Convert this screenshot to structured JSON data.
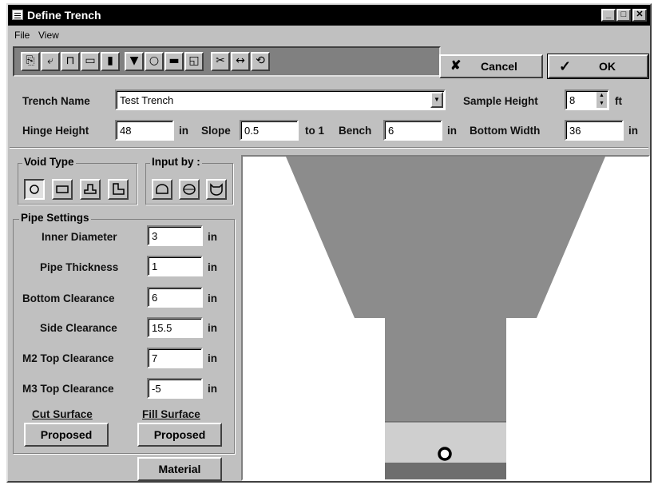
{
  "window": {
    "title": "Define Trench",
    "min_label": "_",
    "max_label": "□",
    "close_label": "✕"
  },
  "menu": {
    "file": "File",
    "view": "View"
  },
  "toolbar": {
    "tools": [
      {
        "icon": "copy-icon",
        "glyph": "⎘"
      },
      {
        "icon": "paste-icon",
        "glyph": "⤶"
      },
      {
        "icon": "trench-shape-icon",
        "glyph": "⊓"
      },
      {
        "icon": "window-icon",
        "glyph": "▭"
      },
      {
        "icon": "chart-icon",
        "glyph": "▮"
      },
      {
        "icon": "funnel-icon",
        "glyph": "▼"
      },
      {
        "icon": "circle-icon",
        "glyph": "○"
      },
      {
        "icon": "rectangle-icon",
        "glyph": "▬"
      },
      {
        "icon": "shape-edit-icon",
        "glyph": "◱"
      },
      {
        "icon": "cut-icon",
        "glyph": "✂"
      },
      {
        "icon": "dimension-icon",
        "glyph": "↔"
      },
      {
        "icon": "rotate-icon",
        "glyph": "⟲"
      }
    ]
  },
  "buttons": {
    "cancel_label": "Cancel",
    "cancel_glyph": "✘",
    "ok_label": "OK",
    "ok_glyph": "✓",
    "material_label": "Material"
  },
  "trench": {
    "name_label": "Trench Name",
    "name_value": "Test Trench",
    "sample_height_label": "Sample Height",
    "sample_height_value": "8",
    "sample_height_unit": "ft",
    "hinge_height_label": "Hinge Height",
    "hinge_height_value": "48",
    "hinge_height_unit": "in",
    "slope_label": "Slope",
    "slope_value": "0.5",
    "slope_unit": "to 1",
    "bench_label": "Bench",
    "bench_value": "6",
    "bench_unit": "in",
    "bottom_width_label": "Bottom Width",
    "bottom_width_value": "36",
    "bottom_width_unit": "in"
  },
  "void_type": {
    "title": "Void Type",
    "options": [
      "circle",
      "rectangle",
      "arch",
      "box-culvert"
    ],
    "selected": 0
  },
  "input_by": {
    "title": "Input by :",
    "options": [
      "arch-input",
      "ellipse-input",
      "cup-input"
    ]
  },
  "pipe_settings": {
    "title": "Pipe Settings",
    "rows": [
      {
        "label": "Inner Diameter",
        "value": "3",
        "unit": "in"
      },
      {
        "label": "Pipe Thickness",
        "value": "1",
        "unit": "in"
      },
      {
        "label": "Bottom Clearance",
        "value": "6",
        "unit": "in"
      },
      {
        "label": "Side Clearance",
        "value": "15.5",
        "unit": "in"
      },
      {
        "label": "M2 Top Clearance",
        "value": "7",
        "unit": "in"
      },
      {
        "label": "M3 Top Clearance",
        "value": "-5",
        "unit": "in"
      }
    ]
  },
  "surfaces": {
    "cut_label": "Cut Surface",
    "cut_value": "Proposed",
    "fill_label": "Fill Surface",
    "fill_value": "Proposed"
  },
  "colors": {
    "trench_fill": "#8c8c8c",
    "bedding_fill": "#cfcfcf",
    "base_fill": "#6e6e6e"
  }
}
